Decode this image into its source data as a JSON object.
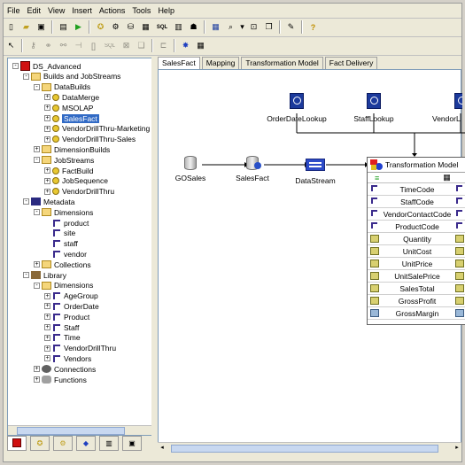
{
  "menu": [
    "File",
    "Edit",
    "View",
    "Insert",
    "Actions",
    "Tools",
    "Help"
  ],
  "toolbar1_icons": [
    "new-icon",
    "open-icon",
    "save-icon",
    "properties-icon",
    "run-icon",
    "explain-icon",
    "build-icon",
    "execute-icon",
    "sql-icon",
    "report-icon",
    "user-icon",
    "grid-icon",
    "zoom-icon",
    "fit-icon",
    "copy-icon",
    "comment-icon",
    "help-icon"
  ],
  "toolbar1_sql": "SQL",
  "toolbar2_icons": [
    "pointer-icon",
    "key-tool-icon",
    "link-tool-icon",
    "lookup-tool-icon",
    "split-tool-icon",
    "bracket-tool-icon",
    "sql-tool-icon",
    "delivery-tool-icon",
    "copy-tool-icon",
    "connect-tool-icon",
    "star-icon",
    "table-icon"
  ],
  "toolbar2_sql": "SQL",
  "tree": [
    {
      "label": "DS_Advanced",
      "level": 0,
      "pm": "-",
      "icon": "red"
    },
    {
      "label": "Builds and JobStreams",
      "level": 1,
      "pm": "-",
      "icon": "folder"
    },
    {
      "label": "DataBuilds",
      "level": 2,
      "pm": "-",
      "icon": "folder"
    },
    {
      "label": "DataMerge",
      "level": 3,
      "pm": "+",
      "icon": "key"
    },
    {
      "label": "MSOLAP",
      "level": 3,
      "pm": "+",
      "icon": "key"
    },
    {
      "label": "SalesFact",
      "level": 3,
      "pm": "+",
      "icon": "key",
      "selected": true
    },
    {
      "label": "VendorDrillThru-Marketing",
      "level": 3,
      "pm": "+",
      "icon": "key"
    },
    {
      "label": "VendorDrillThru-Sales",
      "level": 3,
      "pm": "+",
      "icon": "key"
    },
    {
      "label": "DimensionBuilds",
      "level": 2,
      "pm": "+",
      "icon": "folder"
    },
    {
      "label": "JobStreams",
      "level": 2,
      "pm": "-",
      "icon": "folder"
    },
    {
      "label": "FactBuild",
      "level": 3,
      "pm": "+",
      "icon": "key"
    },
    {
      "label": "JobSequence",
      "level": 3,
      "pm": "+",
      "icon": "key"
    },
    {
      "label": "VendorDrillThru",
      "level": 3,
      "pm": "+",
      "icon": "key"
    },
    {
      "label": "Metadata",
      "level": 1,
      "pm": "-",
      "icon": "meta"
    },
    {
      "label": "Dimensions",
      "level": 2,
      "pm": "-",
      "icon": "folder"
    },
    {
      "label": "product",
      "level": 3,
      "pm": "",
      "icon": "dim"
    },
    {
      "label": "site",
      "level": 3,
      "pm": "",
      "icon": "dim"
    },
    {
      "label": "staff",
      "level": 3,
      "pm": "",
      "icon": "dim"
    },
    {
      "label": "vendor",
      "level": 3,
      "pm": "",
      "icon": "dim"
    },
    {
      "label": "Collections",
      "level": 2,
      "pm": "+",
      "icon": "folder"
    },
    {
      "label": "Library",
      "level": 1,
      "pm": "-",
      "icon": "lib"
    },
    {
      "label": "Dimensions",
      "level": 2,
      "pm": "-",
      "icon": "folder"
    },
    {
      "label": "AgeGroup",
      "level": 3,
      "pm": "+",
      "icon": "dim"
    },
    {
      "label": "OrderDate",
      "level": 3,
      "pm": "+",
      "icon": "dim"
    },
    {
      "label": "Product",
      "level": 3,
      "pm": "+",
      "icon": "dim"
    },
    {
      "label": "Staff",
      "level": 3,
      "pm": "+",
      "icon": "dim"
    },
    {
      "label": "Time",
      "level": 3,
      "pm": "+",
      "icon": "dim"
    },
    {
      "label": "VendorDrillThru",
      "level": 3,
      "pm": "+",
      "icon": "dim"
    },
    {
      "label": "Vendors",
      "level": 3,
      "pm": "+",
      "icon": "dim"
    },
    {
      "label": "Connections",
      "level": 2,
      "pm": "+",
      "icon": "conn"
    },
    {
      "label": "Functions",
      "level": 2,
      "pm": "+",
      "icon": "func"
    }
  ],
  "tabs": [
    "SalesFact",
    "Mapping",
    "Transformation Model",
    "Fact Delivery"
  ],
  "nodes": {
    "gosales": "GOSales",
    "salesfact": "SalesFact",
    "datastream": "DataStream",
    "orderdate": "OrderDateLookup",
    "staff": "StaffLookup",
    "vendor": "VendorL"
  },
  "tm_title": "Transformation Model",
  "tm_rows": [
    {
      "label": "TimeCode",
      "type": "dim"
    },
    {
      "label": "StaffCode",
      "type": "dim"
    },
    {
      "label": "VendorContactCode",
      "type": "dim"
    },
    {
      "label": "ProductCode",
      "type": "dim"
    },
    {
      "label": "Quantity",
      "type": "meas"
    },
    {
      "label": "UnitCost",
      "type": "meas"
    },
    {
      "label": "UnitPrice",
      "type": "meas"
    },
    {
      "label": "UnitSalePrice",
      "type": "meas"
    },
    {
      "label": "SalesTotal",
      "type": "meas"
    },
    {
      "label": "GrossProfit",
      "type": "meas"
    },
    {
      "label": "GrossMargin",
      "type": "calc"
    }
  ]
}
